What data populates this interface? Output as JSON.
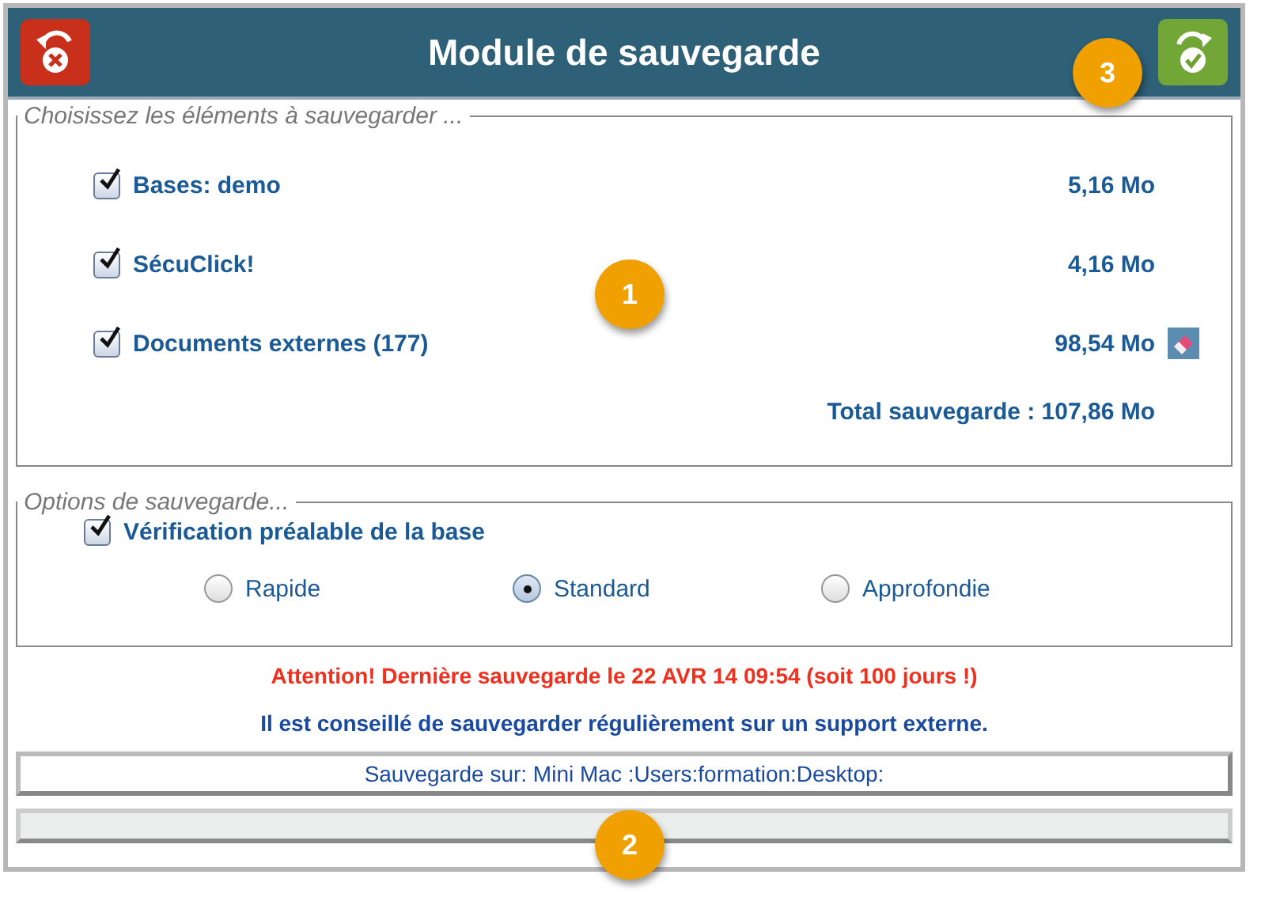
{
  "window": {
    "title": "Module de sauvegarde"
  },
  "elements_group": {
    "legend": "Choisissez les éléments à sauvegarder ...",
    "items": [
      {
        "name": "Bases: demo",
        "size": "5,16 Mo",
        "checked": true,
        "erasable": false
      },
      {
        "name": "SécuClick!",
        "size": "4,16 Mo",
        "checked": true,
        "erasable": false
      },
      {
        "name": "Documents externes (177)",
        "size": "98,54 Mo",
        "checked": true,
        "erasable": true
      }
    ],
    "total": "Total sauvegarde : 107,86 Mo"
  },
  "options_group": {
    "legend": "Options de sauvegarde...",
    "verify": {
      "label": "Vérification préalable de la base",
      "checked": true
    },
    "modes": [
      {
        "label": "Rapide",
        "selected": false
      },
      {
        "label": "Standard",
        "selected": true
      },
      {
        "label": "Approfondie",
        "selected": false
      }
    ]
  },
  "warning": "Attention! Dernière sauvegarde le 22 AVR 14  09:54 (soit 100 jours !)",
  "advice": "Il est conseillé de sauvegarder régulièrement sur un support externe.",
  "destination": "Sauvegarde sur: Mini Mac :Users:formation:Desktop:",
  "progress": {
    "level": 0
  },
  "callouts": [
    {
      "label": "1"
    },
    {
      "label": "2"
    },
    {
      "label": "3"
    }
  ]
}
